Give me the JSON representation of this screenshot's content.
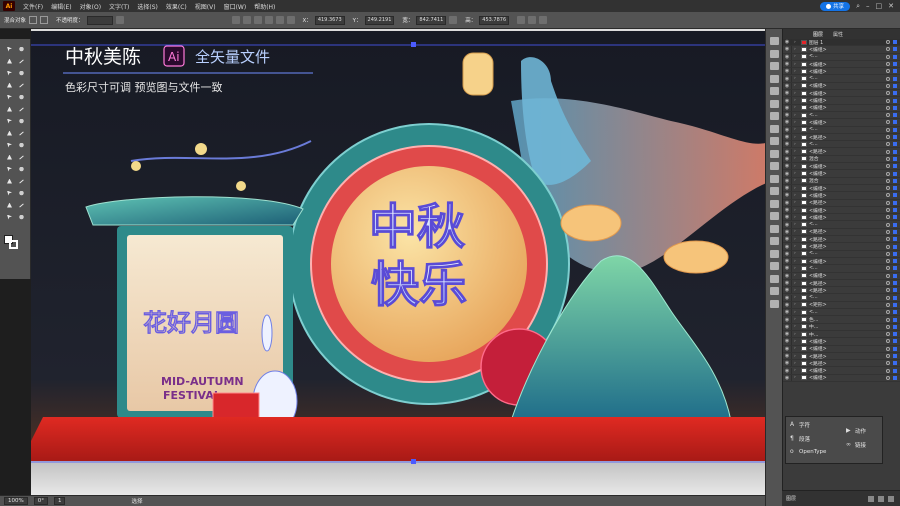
{
  "app": {
    "logo": "Ai"
  },
  "menubar": {
    "items": [
      "文件(F)",
      "编辑(E)",
      "对象(O)",
      "文字(T)",
      "选择(S)",
      "效果(C)",
      "视图(V)",
      "窗口(W)",
      "帮助(H)"
    ],
    "share_label": "共享",
    "icons": [
      "search-icon",
      "minimize-icon",
      "maximize-icon",
      "close-icon"
    ]
  },
  "controlbar": {
    "selection_label": "混合对象",
    "opacity_label": "不透明度：",
    "x_label": "X：",
    "x_value": "419.3673",
    "y_label": "Y：",
    "y_value": "249.2191",
    "w_label": "宽：",
    "w_value": "842.7411",
    "h_label": "高：",
    "h_value": "453.7876"
  },
  "artwork": {
    "title": "中秋美陈",
    "ai_badge": "Ai",
    "vector_text": "全矢量文件",
    "subtitle": "色彩尺寸可调   预览图与文件一致",
    "main_title_line1": "中秋",
    "main_title_line2": "快乐",
    "left_title": "花好月圆",
    "festival_line1": "MID-AUTUMN",
    "festival_line2": "FESTIVAL",
    "colors": {
      "background": "#1c1f2a",
      "floor_red": "#d8272b",
      "gold": "#f2c06a",
      "teal": "#2e8a8a",
      "moon": "#f6d28a",
      "selection_blue": "#4b5bff"
    }
  },
  "layers_panel": {
    "tab_layers": "图层",
    "tab_properties": "属性",
    "top_layer": "图层 1",
    "rows": [
      "<编组>",
      "<...",
      "<编组>",
      "<编组>",
      "<...",
      "<编组>",
      "<编组>",
      "<编组>",
      "<编组>",
      "<...",
      "<编组>",
      "<...",
      "<路径>",
      "<...",
      "<路径>",
      "混合",
      "<编组>",
      "<编组>",
      "混合",
      "<编组>",
      "<编组>",
      "<路径>",
      "<编组>",
      "<编组>",
      "<...",
      "<路径>",
      "<路径>",
      "<路径>",
      "<...",
      "<编组>",
      "<...",
      "<编组>",
      "<路径>",
      "<路径>",
      "<...",
      "<矩形>",
      "<...",
      "色...",
      "中...",
      "中...",
      "<编组>",
      "<编组>",
      "<路径>",
      "<路径>",
      "<编组>",
      "<编组>"
    ],
    "footer_label": "图层"
  },
  "float_panel": {
    "character": "字符",
    "paragraph": "段落",
    "opentype": "OpenType",
    "actions": "动作",
    "links": "链接"
  },
  "statusbar": {
    "zoom": "100%",
    "rotate": "0°",
    "page": "1",
    "tool": "选择"
  }
}
